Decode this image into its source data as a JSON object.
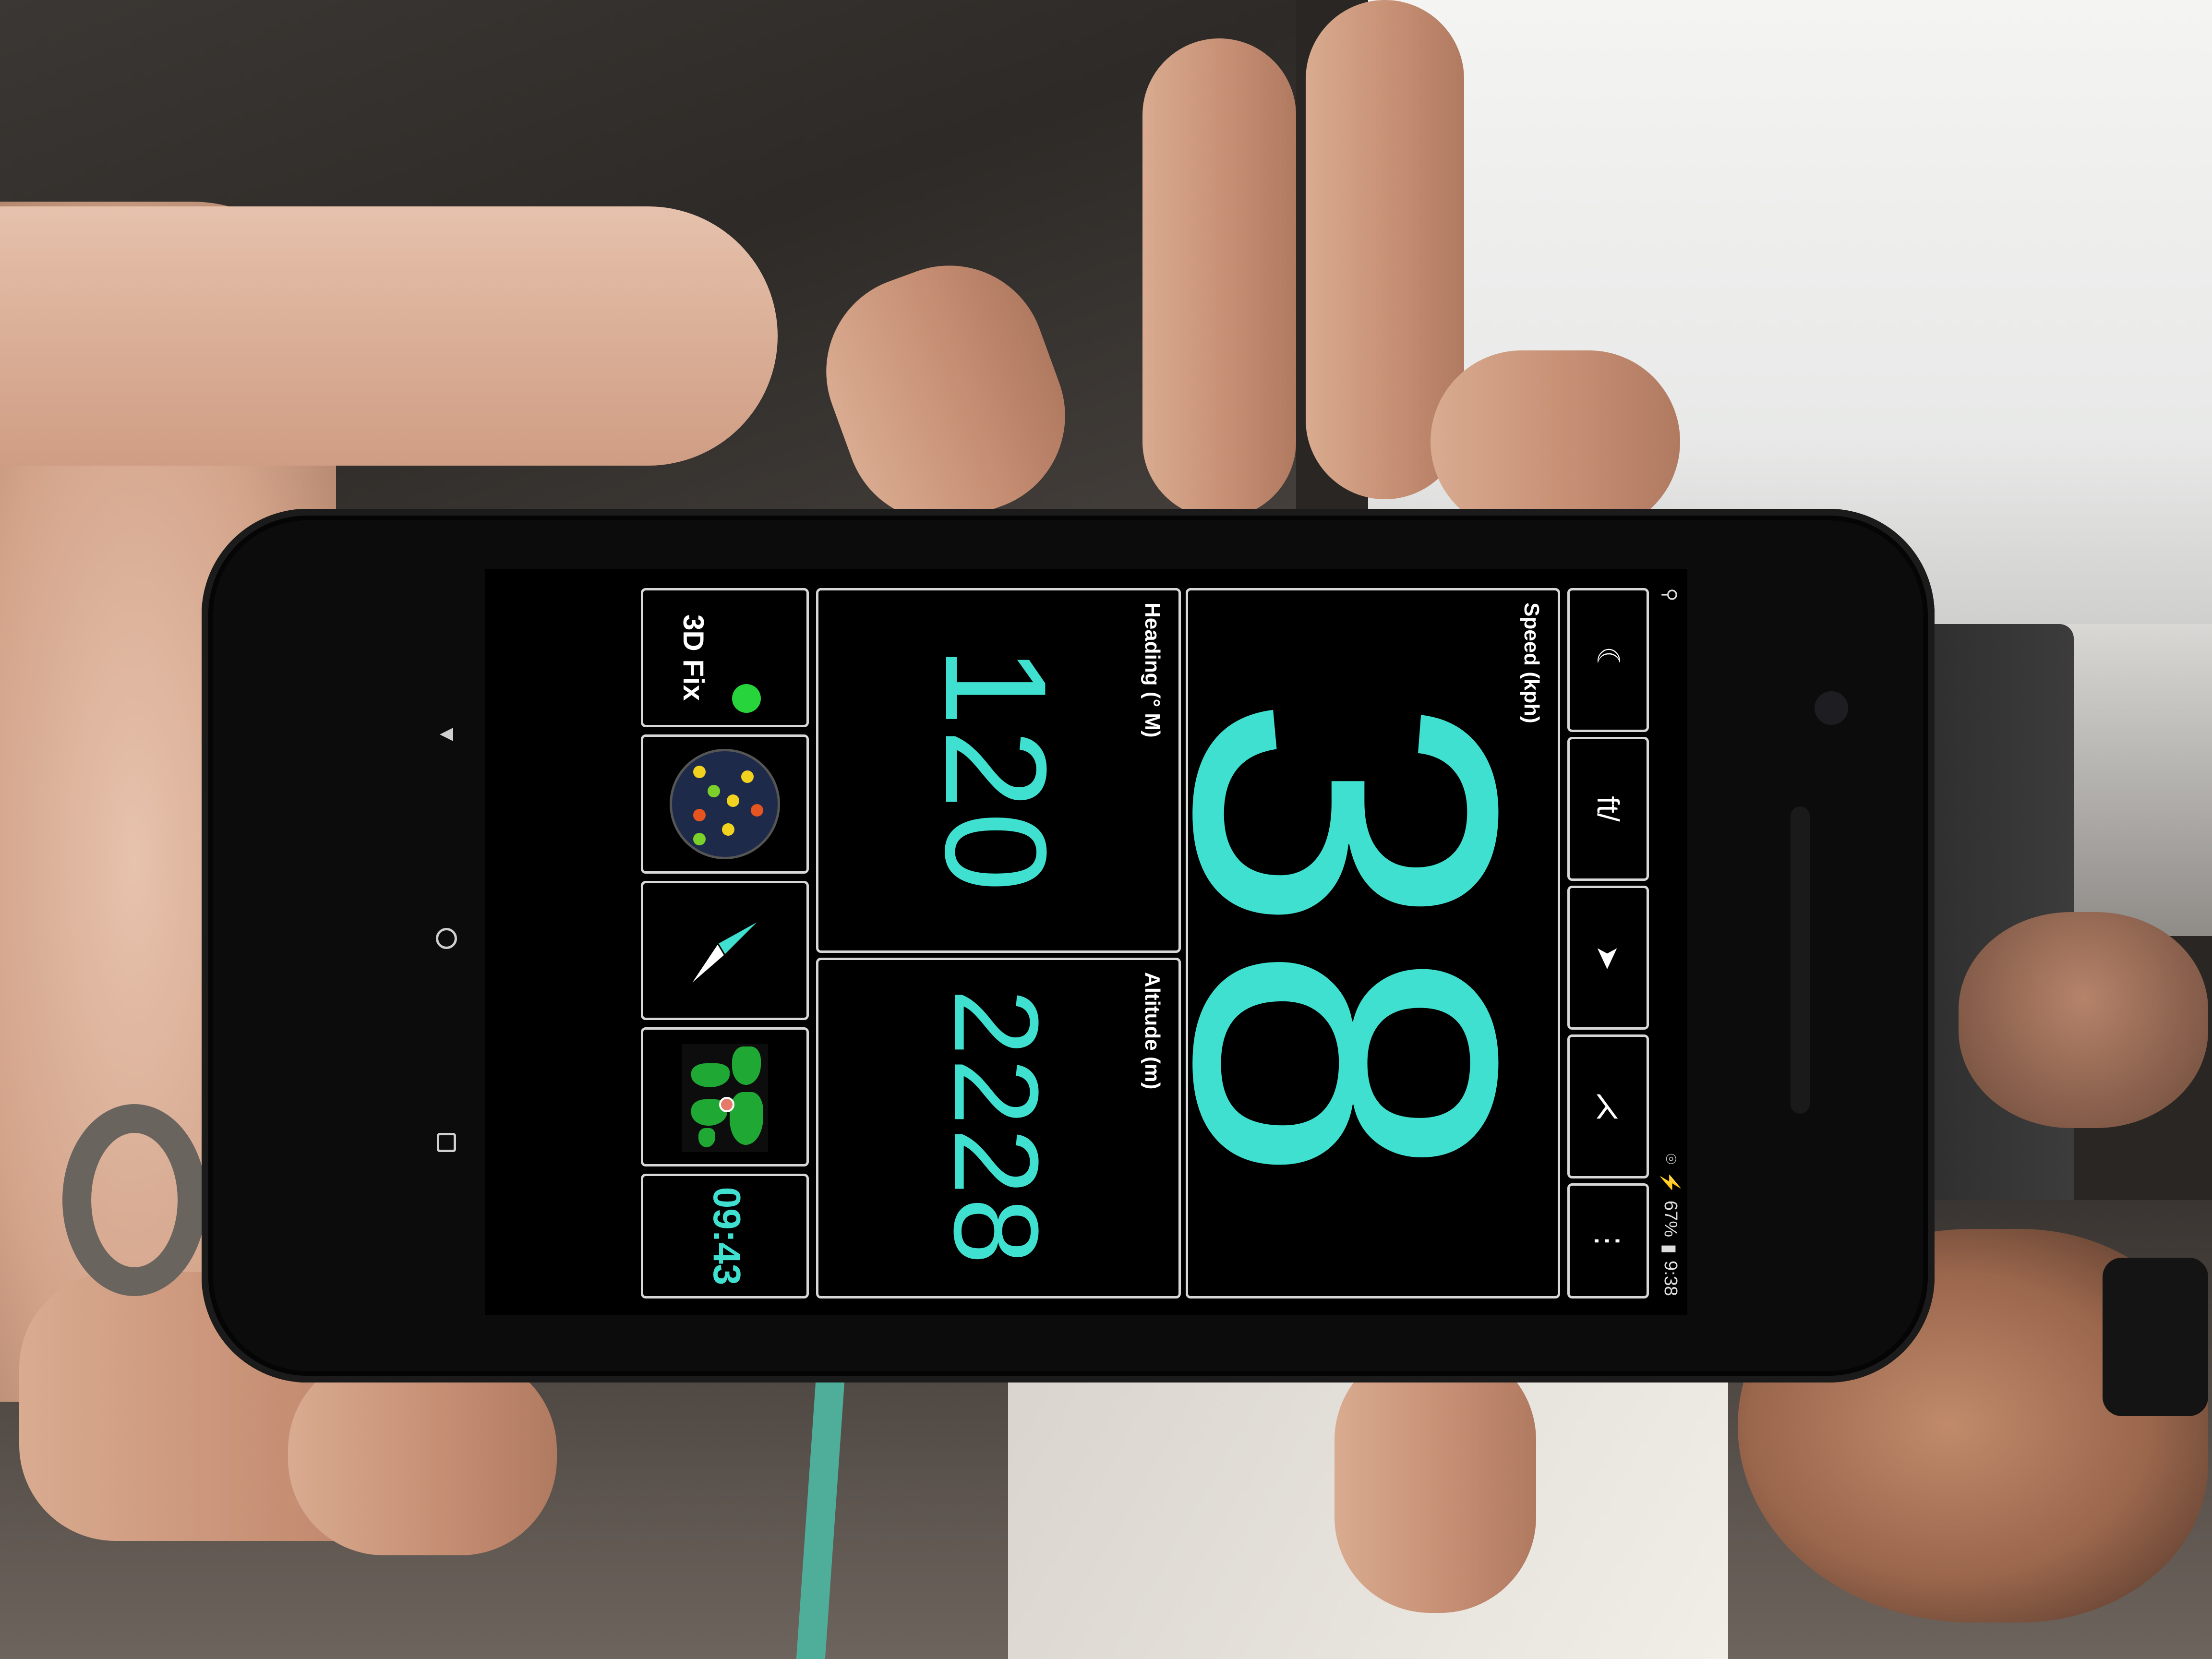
{
  "status_bar": {
    "left_icon": "search-icon",
    "battery": "67%",
    "time": "9:38"
  },
  "toolbar": [
    {
      "icon": "moon-icon",
      "glyph": "☾"
    },
    {
      "icon": "units-icon",
      "glyph": "ft/"
    },
    {
      "icon": "navigation-arrow-icon",
      "glyph": "➤"
    },
    {
      "icon": "share-icon",
      "glyph": "⋌"
    },
    {
      "icon": "overflow-menu-icon",
      "glyph": "⋮"
    }
  ],
  "speed": {
    "label": "Speed (kph)",
    "value": "38"
  },
  "heading": {
    "label": "Heading (° M)",
    "value": "120"
  },
  "altitude": {
    "label": "Altitude (m)",
    "value": "2228"
  },
  "bottom_bar": {
    "fix_label": "3D Fix",
    "fix_color": "#27d43b",
    "clock": "09:43"
  },
  "colors": {
    "accent": "#3fe0d0",
    "panel_border": "#d7d7d7"
  }
}
